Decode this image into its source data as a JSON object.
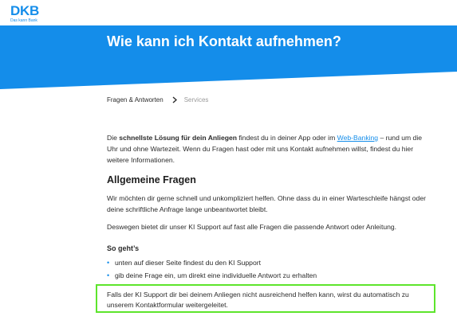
{
  "brand": {
    "logo": "DKB",
    "tagline": "Das kann Bank",
    "color": "#148dea"
  },
  "hero": {
    "title": "Wie kann ich Kontakt aufnehmen?"
  },
  "breadcrumb": {
    "items": [
      "Fragen & Antworten",
      "Services"
    ],
    "separator_icon": "chevron-right-icon"
  },
  "intro": {
    "before": "Die ",
    "bold": "schnellste Lösung für dein Anliegen",
    "middle": " findest du in deiner App oder im ",
    "link": "Web-Banking",
    "after": " – rund um die Uhr und ohne Wartezeit. Wenn du Fragen hast oder mit uns Kontakt aufnehmen willst, findest du hier weitere Informationen."
  },
  "general": {
    "heading": "Allgemeine Fragen",
    "paragraph1": "Wir möchten dir gerne schnell und unkompliziert helfen. Ohne dass du in einer Warteschleife hängst oder deine schriftliche Anfrage lange unbeantwortet bleibt.",
    "paragraph2": "Deswegen bietet dir unser KI Support auf fast alle Fragen die passende Antwort oder Anleitung."
  },
  "howto": {
    "heading": "So geht’s",
    "steps": [
      "unten auf dieser Seite findest du den KI Support",
      "gib deine Frage ein, um direkt eine individuelle Antwort zu erhalten"
    ]
  },
  "note": {
    "text": "Falls der KI Support dir bei deinem Anliegen nicht ausreichend helfen kann, wirst du automatisch zu unserem Kontaktformular weitergeleitet.",
    "highlight_color": "#5de52c"
  }
}
